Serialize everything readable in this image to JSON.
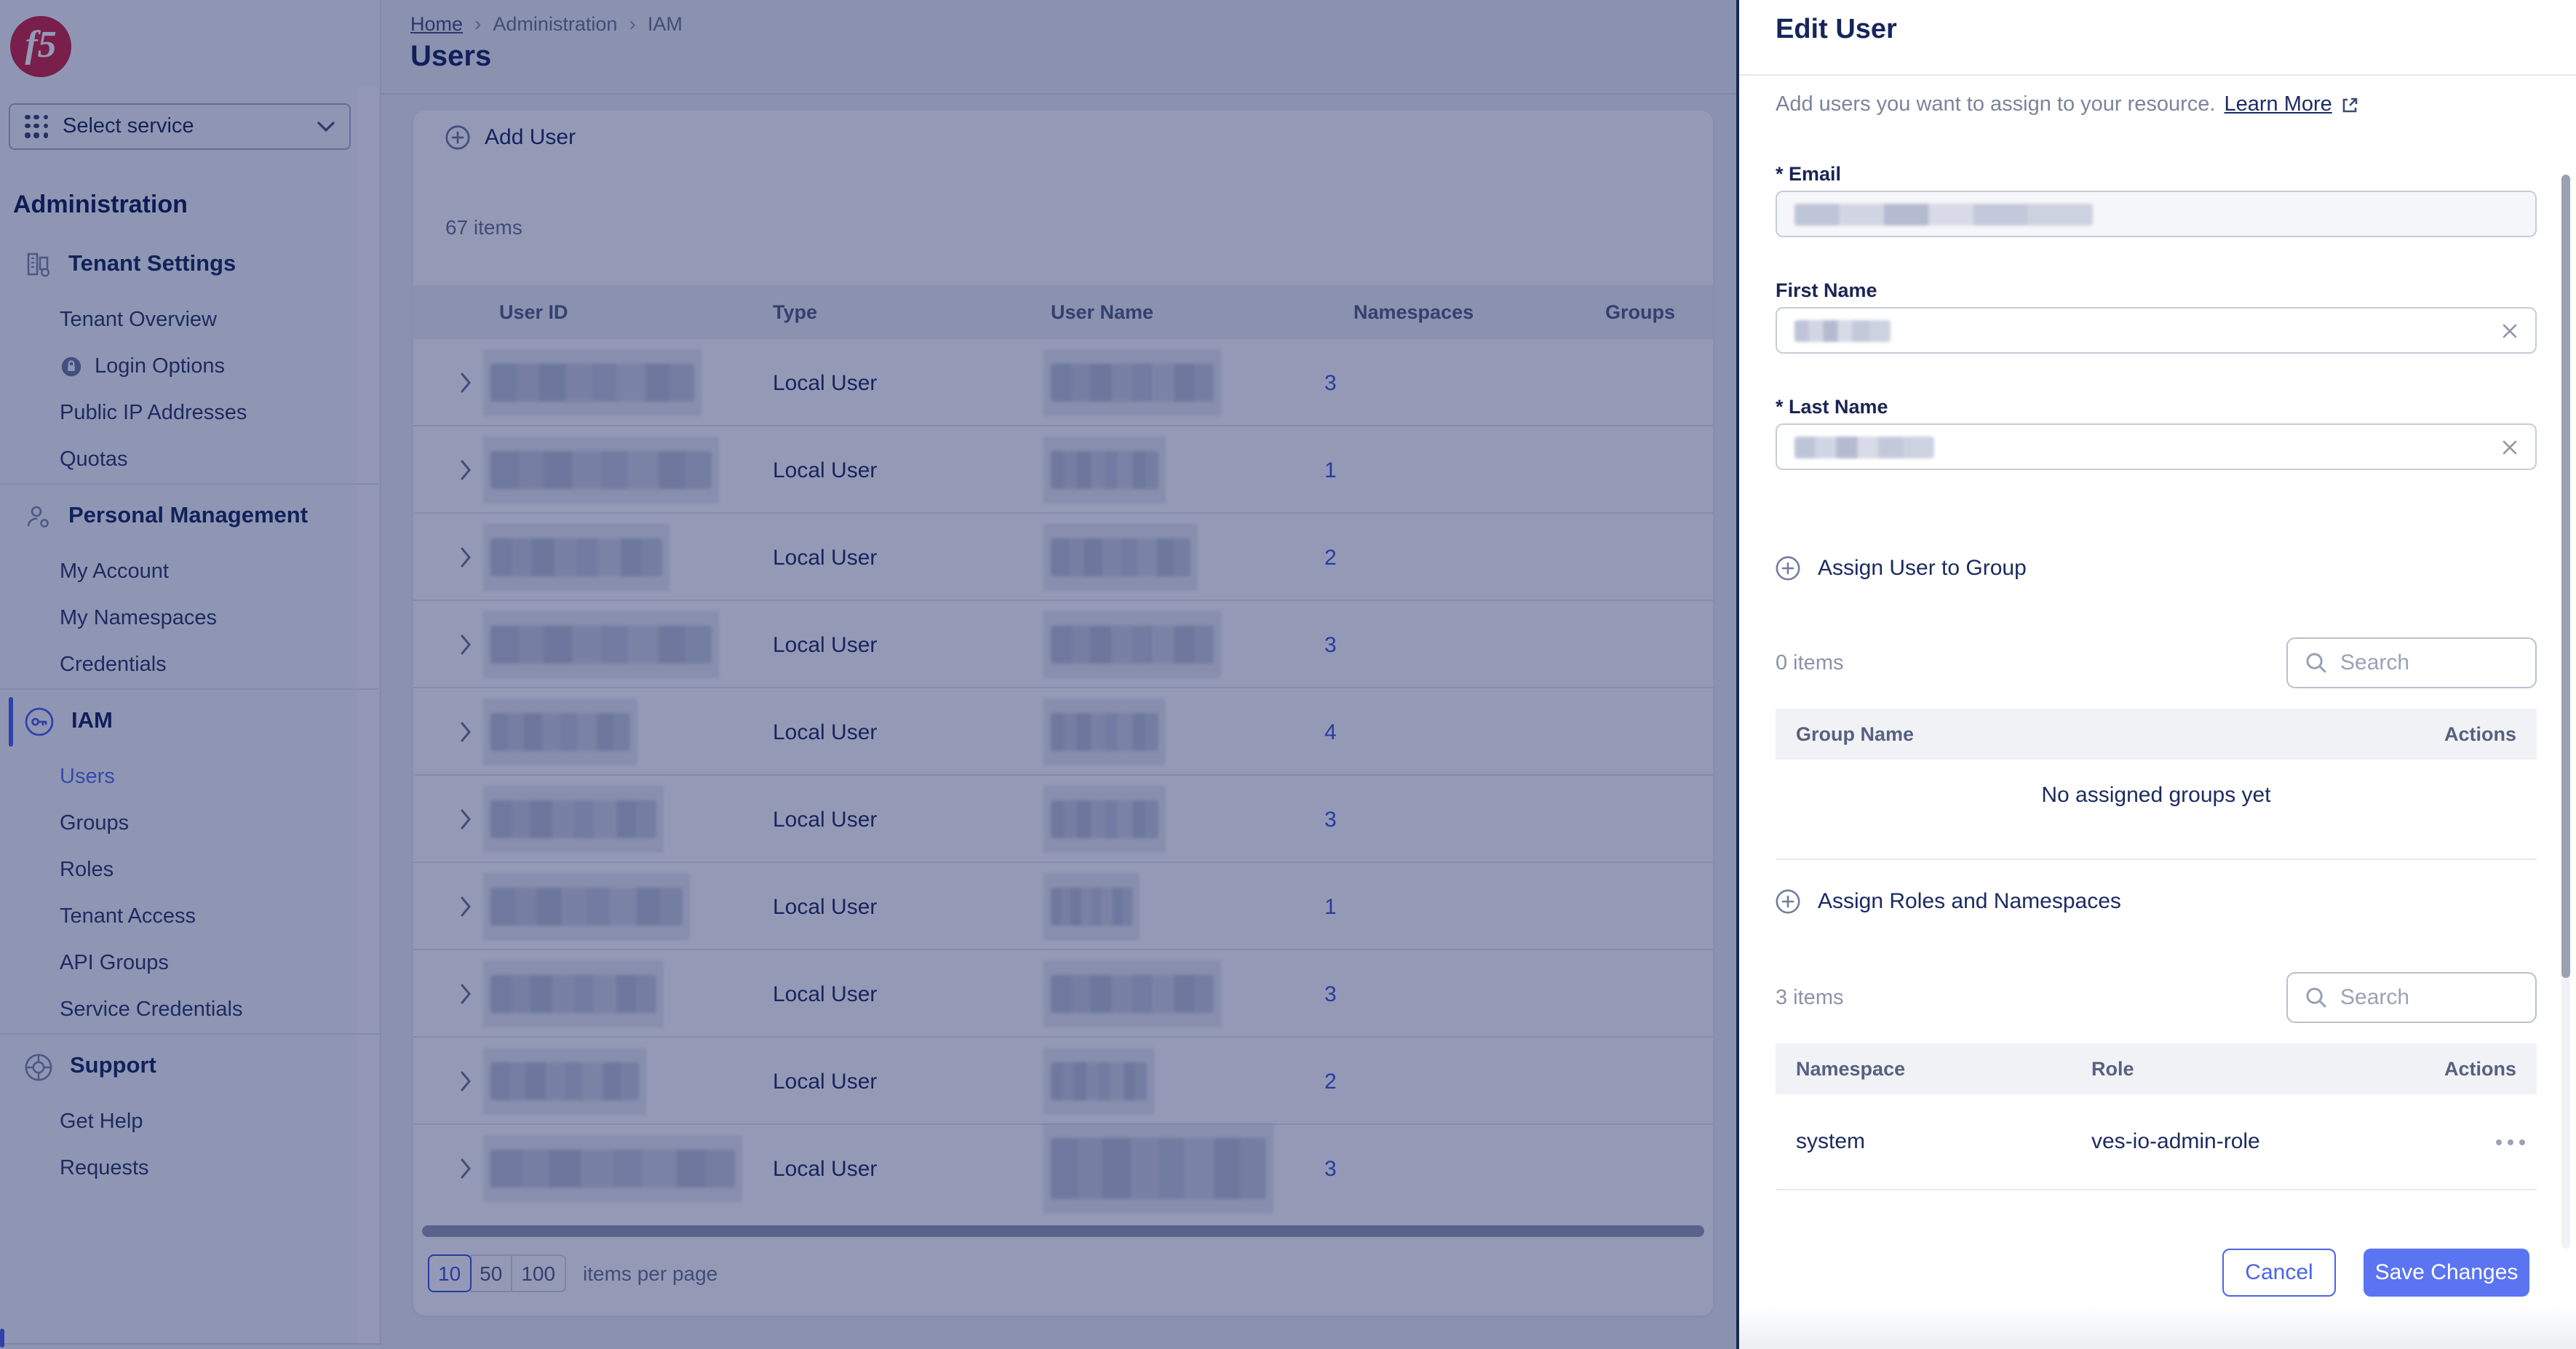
{
  "sidebar": {
    "logo_text": "f5",
    "service_selector": {
      "label": "Select service"
    },
    "heading": "Administration",
    "sections": [
      {
        "title": "Tenant Settings",
        "icon": "building-icon",
        "active": false,
        "items": [
          {
            "label": "Tenant Overview"
          },
          {
            "label": "Login Options",
            "icon": "lock-icon"
          },
          {
            "label": "Public IP Addresses"
          },
          {
            "label": "Quotas"
          }
        ]
      },
      {
        "title": "Personal Management",
        "icon": "person-gear-icon",
        "active": false,
        "items": [
          {
            "label": "My Account"
          },
          {
            "label": "My Namespaces"
          },
          {
            "label": "Credentials"
          }
        ]
      },
      {
        "title": "IAM",
        "icon": "key-icon",
        "active": true,
        "items": [
          {
            "label": "Users",
            "active": true
          },
          {
            "label": "Groups"
          },
          {
            "label": "Roles"
          },
          {
            "label": "Tenant Access"
          },
          {
            "label": "API Groups"
          },
          {
            "label": "Service Credentials"
          }
        ]
      },
      {
        "title": "Support",
        "icon": "life-ring-icon",
        "active": false,
        "items": [
          {
            "label": "Get Help"
          },
          {
            "label": "Requests"
          }
        ]
      }
    ]
  },
  "breadcrumb": {
    "items": [
      "Home",
      "Administration",
      "IAM"
    ]
  },
  "page": {
    "title": "Users"
  },
  "toolbar": {
    "add_user_label": "Add User"
  },
  "list": {
    "count_label": "67 items",
    "columns": [
      "User ID",
      "Type",
      "User Name",
      "Namespaces",
      "Groups"
    ],
    "rows": [
      {
        "type": "Local User",
        "namespaces": "3",
        "user_id_redacted": true,
        "user_name_redacted": true
      },
      {
        "type": "Local User",
        "namespaces": "1",
        "user_id_redacted": true,
        "user_name_redacted": true
      },
      {
        "type": "Local User",
        "namespaces": "2",
        "user_id_redacted": true,
        "user_name_redacted": true
      },
      {
        "type": "Local User",
        "namespaces": "3",
        "user_id_redacted": true,
        "user_name_redacted": true
      },
      {
        "type": "Local User",
        "namespaces": "4",
        "user_id_redacted": true,
        "user_name_redacted": true
      },
      {
        "type": "Local User",
        "namespaces": "3",
        "user_id_redacted": true,
        "user_name_redacted": true
      },
      {
        "type": "Local User",
        "namespaces": "1",
        "user_id_redacted": true,
        "user_name_redacted": true
      },
      {
        "type": "Local User",
        "namespaces": "3",
        "user_id_redacted": true,
        "user_name_redacted": true
      },
      {
        "type": "Local User",
        "namespaces": "2",
        "user_id_redacted": true,
        "user_name_redacted": true
      },
      {
        "type": "Local User",
        "namespaces": "3",
        "user_id_redacted": true,
        "user_name_redacted": true
      }
    ],
    "pagination": {
      "options": [
        "10",
        "50",
        "100"
      ],
      "selected": "10",
      "label": "items per page"
    }
  },
  "panel": {
    "title": "Edit User",
    "description": "Add users you want to assign to your resource.",
    "learn_more_label": "Learn More",
    "fields": {
      "email_label": "* Email",
      "first_name_label": "First Name",
      "last_name_label": "* Last Name",
      "email_redacted": true,
      "first_name_redacted": true,
      "last_name_redacted": true
    },
    "groups_section": {
      "action_label": "Assign User to Group",
      "count_label": "0 items",
      "search_placeholder": "Search",
      "columns": [
        "Group Name",
        "Actions"
      ],
      "empty_text": "No assigned groups yet"
    },
    "roles_section": {
      "action_label": "Assign Roles and Namespaces",
      "count_label": "3 items",
      "search_placeholder": "Search",
      "columns": [
        "Namespace",
        "Role",
        "Actions"
      ],
      "rows": [
        {
          "namespace": "system",
          "role": "ves-io-admin-role"
        }
      ]
    },
    "footer": {
      "cancel_label": "Cancel",
      "save_label": "Save Changes"
    }
  },
  "colors": {
    "accent_blue": "#5571EE",
    "link_blue": "#3E57DD",
    "navy_text": "#16265A",
    "f5_red": "#CE2540",
    "overlay": "rgba(12,24,88,0.44)",
    "page_bg": "#EEF0F4",
    "sidebar_bg": "#F7F8FA"
  }
}
